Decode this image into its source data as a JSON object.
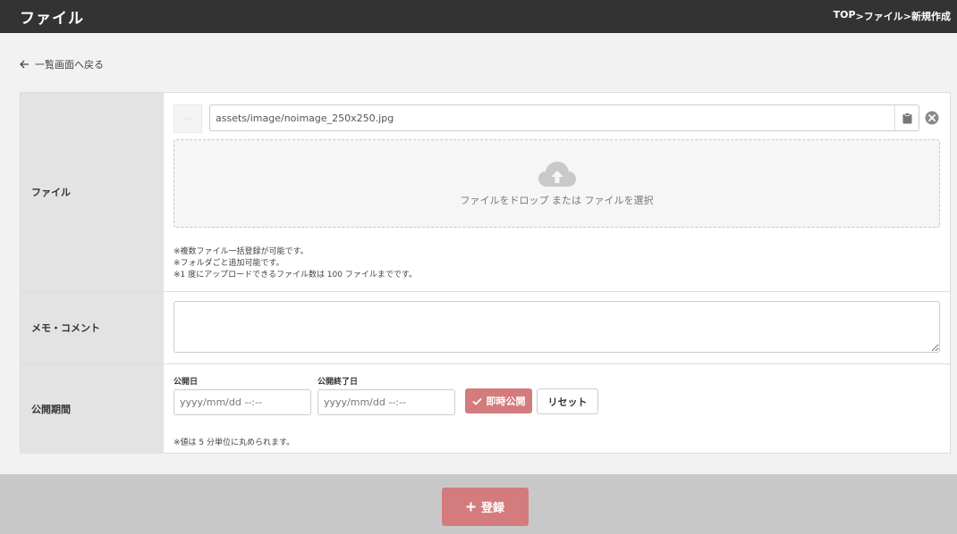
{
  "header": {
    "title": "ファイル",
    "breadcrumb": [
      "TOP",
      ">ファイル",
      ">新規作成"
    ]
  },
  "back_link": {
    "label": "一覧画面へ戻る",
    "icon": "arrow-left-icon"
  },
  "form": {
    "file": {
      "label": "ファイル",
      "thumb_placeholder": "···",
      "path_value": "assets/image/noimage_250x250.jpg",
      "dropzone_text": "ファイルをドロップ または ファイルを選択",
      "notes": [
        "※複数ファイル一括登録が可能です。",
        "※フォルダごと追加可能です。",
        "※1 度にアップロードできるファイル数は 100 ファイルまでです。"
      ]
    },
    "memo": {
      "label": "メモ・コメント",
      "value": ""
    },
    "period": {
      "label": "公開期間",
      "start_label": "公開日",
      "start_placeholder": "yyyy/mm/dd --:--",
      "end_label": "公開終了日",
      "end_placeholder": "yyyy/mm/dd --:--",
      "now_button": "即時公開",
      "reset_button": "リセット",
      "note": "※値は 5 分単位に丸められます。"
    }
  },
  "footer": {
    "register_button": "登録"
  },
  "colors": {
    "header_bg": "#333333",
    "accent": "#d47b7d",
    "label_bg": "#e3e3e3",
    "footer_bg": "#c8c8c8"
  }
}
